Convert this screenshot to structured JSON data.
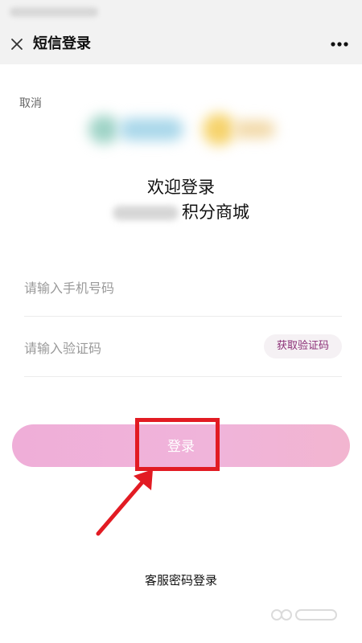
{
  "nav": {
    "title": "短信登录",
    "close_icon": "close-icon",
    "more_icon": "more-dots-icon"
  },
  "page": {
    "cancel_label": "取消",
    "welcome_text": "欢迎登录",
    "shop_name_suffix": "积分商城"
  },
  "form": {
    "phone": {
      "placeholder": "请输入手机号码",
      "value": ""
    },
    "code": {
      "placeholder": "请输入验证码",
      "value": ""
    },
    "get_code_label": "获取验证码",
    "login_label": "登录"
  },
  "footer": {
    "service_password_login": "客服密码登录"
  },
  "colors": {
    "accent_text": "#8b2f76",
    "login_button": "#efaed8",
    "annotation_red": "#e21b23"
  }
}
